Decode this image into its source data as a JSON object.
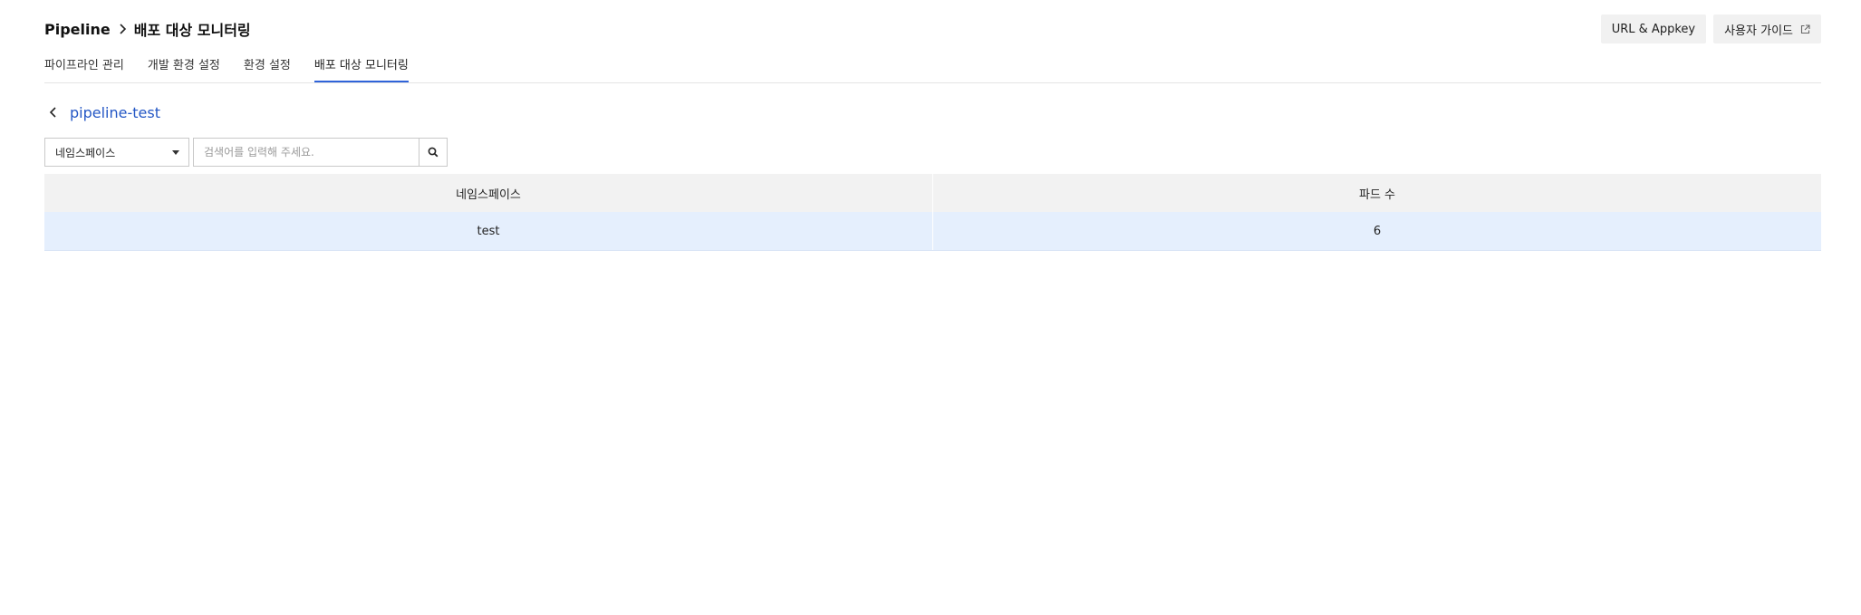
{
  "header": {
    "breadcrumb_root": "Pipeline",
    "breadcrumb_current": "배포 대상 모니터링",
    "url_appkey_label": "URL & Appkey",
    "user_guide_label": "사용자 가이드"
  },
  "tabs": [
    {
      "label": "파이프라인 관리",
      "active": false
    },
    {
      "label": "개발 환경 설정",
      "active": false
    },
    {
      "label": "환경 설정",
      "active": false
    },
    {
      "label": "배포 대상 모니터링",
      "active": true
    }
  ],
  "subtitle": {
    "text": "pipeline-test"
  },
  "search": {
    "select_value": "네임스페이스",
    "placeholder": "검색어를 입력해 주세요."
  },
  "table": {
    "columns": [
      "네임스페이스",
      "파드 수"
    ],
    "rows": [
      [
        "test",
        "6"
      ]
    ]
  },
  "colors": {
    "accent": "#2f63d9",
    "link": "#2457c5",
    "header_bg": "#f2f2f2",
    "row_selected_bg": "#e5effd"
  }
}
